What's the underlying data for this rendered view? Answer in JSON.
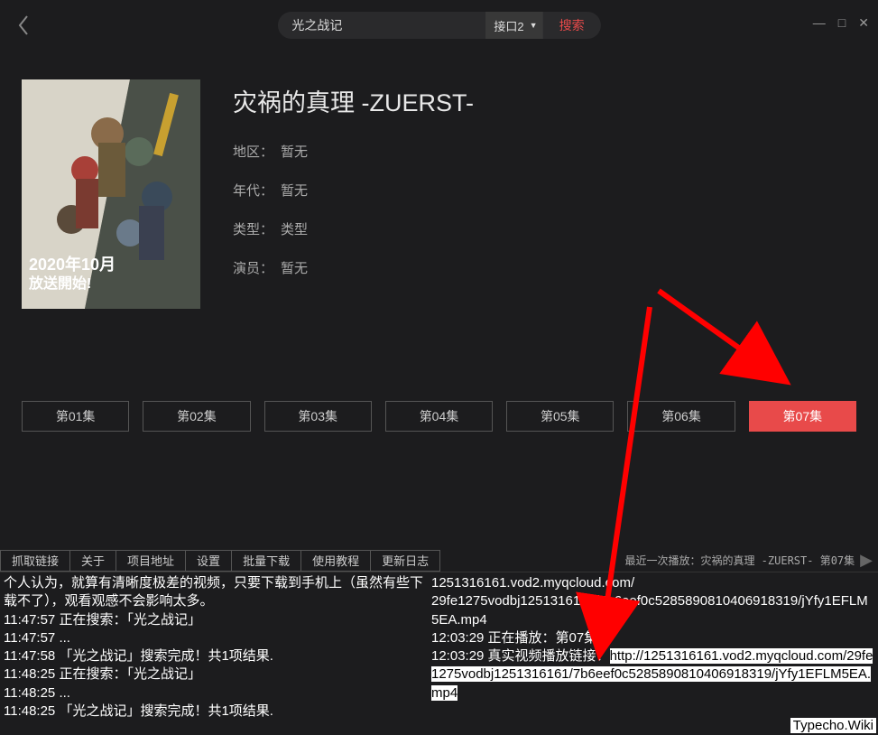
{
  "search": {
    "value": "光之战记",
    "interface": "接口2",
    "button": "搜索"
  },
  "media": {
    "title": "灾祸的真理 -ZUERST-",
    "region_label": "地区：",
    "region_value": "暂无",
    "year_label": "年代：",
    "year_value": "暂无",
    "type_label": "类型：",
    "type_value": "类型",
    "cast_label": "演员：",
    "cast_value": "暂无",
    "poster_badge_line1": "2020年10月",
    "poster_badge_line2": "放送開始!"
  },
  "episodes": [
    {
      "label": "第01集",
      "active": false
    },
    {
      "label": "第02集",
      "active": false
    },
    {
      "label": "第03集",
      "active": false
    },
    {
      "label": "第04集",
      "active": false
    },
    {
      "label": "第05集",
      "active": false
    },
    {
      "label": "第06集",
      "active": false
    },
    {
      "label": "第07集",
      "active": true
    }
  ],
  "tabs": {
    "grab": "抓取链接",
    "about": "关于",
    "project": "项目地址",
    "settings": "设置",
    "batch": "批量下载",
    "tutorial": "使用教程",
    "changelog": "更新日志"
  },
  "last_played": "最近一次播放：灾祸的真理 -ZUERST-  第07集",
  "log_left": {
    "l1": "个人认为，就算有清晰度极差的视频，只要下载到手机上（虽然有些下载不了），观看观感不会影响太多。",
    "l2": "11:47:57 正在搜索：「光之战记」",
    "l3": "11:47:57 ...",
    "l4": "11:47:58 「光之战记」搜索完成！共1项结果.",
    "l5": "11:48:25 正在搜索：「光之战记」",
    "l6": "11:48:25 ...",
    "l7": "11:48:25 「光之战记」搜索完成！共1项结果."
  },
  "log_right": {
    "r1a": "1251316161.vod2.myqcloud.com/",
    "r1b": "29fe1275vodbj1251316161/7b6eef0c5285890810406918319/jYfy1EFLM5EA.mp4",
    "r2": "12:03:29 正在播放：第07集",
    "r3_prefix": "12:03:29 真实视频播放链接：",
    "r3_url": "http://1251316161.vod2.myqcloud.com/29fe1275vodbj1251316161/7b6eef0c5285890810406918319/jYfy1EFLM5EA.mp4"
  },
  "watermark": "Typecho.Wiki"
}
